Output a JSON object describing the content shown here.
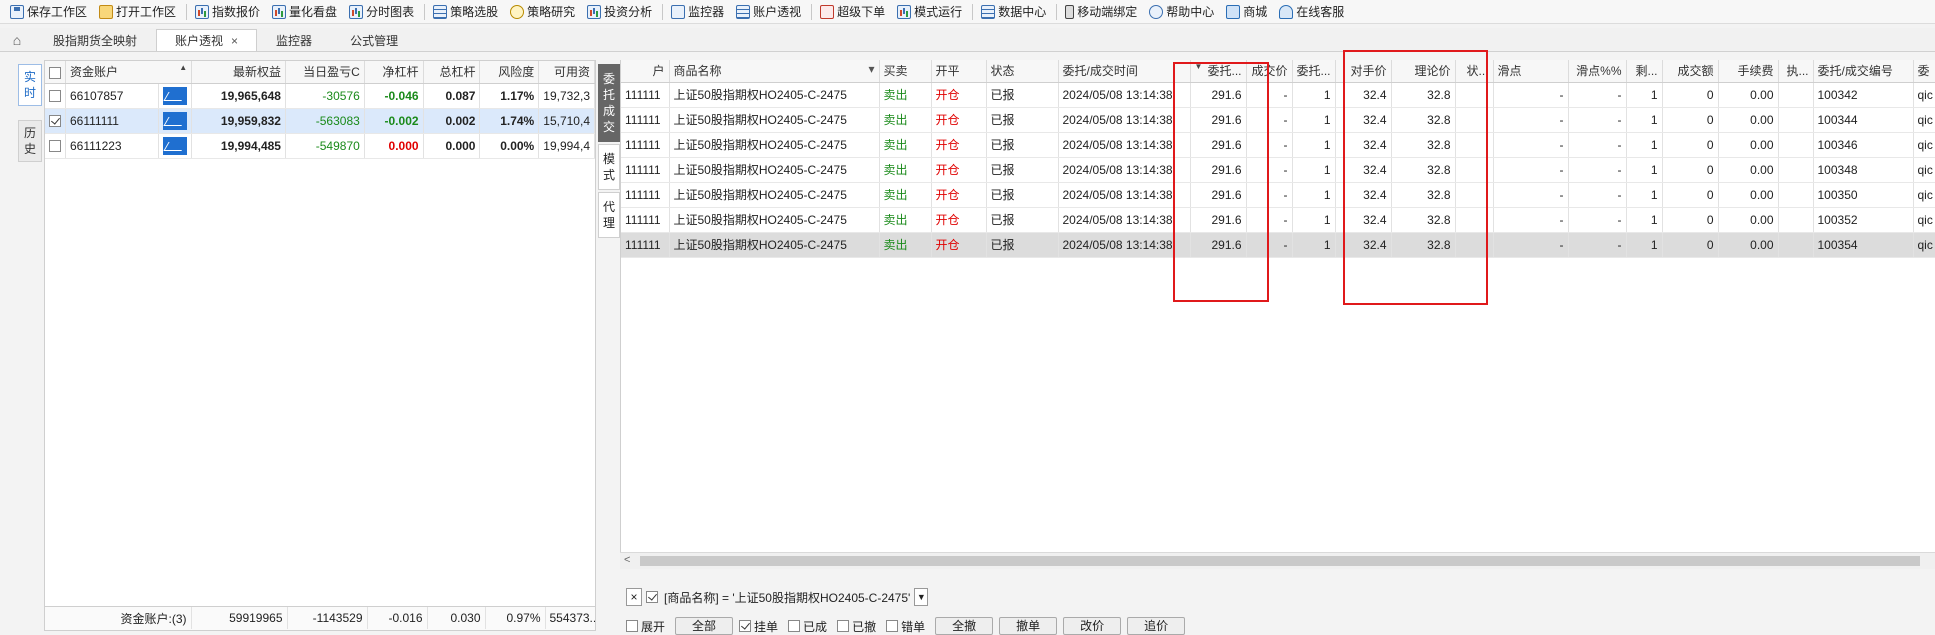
{
  "toolbar": [
    {
      "label": "保存工作区",
      "icon": "save-icon"
    },
    {
      "label": "打开工作区",
      "icon": "folder-icon"
    },
    {
      "label": "指数报价",
      "icon": "chart-icon"
    },
    {
      "label": "量化看盘",
      "icon": "chart-icon"
    },
    {
      "label": "分时图表",
      "icon": "chart-icon"
    },
    {
      "label": "策略选股",
      "icon": "grid-icon"
    },
    {
      "label": "策略研究",
      "icon": "bulb-icon"
    },
    {
      "label": "投资分析",
      "icon": "chart-icon"
    },
    {
      "label": "监控器",
      "icon": "monitor-icon"
    },
    {
      "label": "账户透视",
      "icon": "grid-icon"
    },
    {
      "label": "超级下单",
      "icon": "red-icon"
    },
    {
      "label": "模式运行",
      "icon": "chart-icon"
    },
    {
      "label": "数据中心",
      "icon": "grid-icon"
    },
    {
      "label": "移动端绑定",
      "icon": "phone-icon"
    },
    {
      "label": "帮助中心",
      "icon": "help-icon"
    },
    {
      "label": "商城",
      "icon": "shop-icon"
    },
    {
      "label": "在线客服",
      "icon": "person-icon"
    }
  ],
  "tabs": [
    {
      "label": "股指期货全映射",
      "active": false
    },
    {
      "label": "账户透视",
      "active": true,
      "close": "×"
    },
    {
      "label": "监控器",
      "active": false
    },
    {
      "label": "公式管理",
      "active": false
    }
  ],
  "left_vtabs": [
    {
      "label": "实\n时",
      "active": true
    },
    {
      "label": "历\n史",
      "active": false
    }
  ],
  "left_table": {
    "headers": [
      "资金账户",
      "最新权益",
      "当日盈亏C",
      "净杠杆",
      "总杠杆",
      "风险度",
      "可用资"
    ],
    "rows": [
      {
        "checked": false,
        "account": "66107857",
        "equity": "19,965,648",
        "pnl": "-30576",
        "net_lev": "-0.046",
        "tot_lev": "0.087",
        "risk": "1.17%",
        "avail": "19,732,3"
      },
      {
        "checked": true,
        "account": "66111111",
        "equity": "19,959,832",
        "pnl": "-563083",
        "net_lev": "-0.002",
        "tot_lev": "0.002",
        "risk": "1.74%",
        "avail": "15,710,4"
      },
      {
        "checked": false,
        "account": "66111223",
        "equity": "19,994,485",
        "pnl": "-549870",
        "net_lev": "0.000",
        "tot_lev": "0.000",
        "risk": "0.00%",
        "avail": "19,994,4"
      }
    ],
    "footer": {
      "label": "资金账户:(3)",
      "equity": "59919965",
      "pnl": "-1143529",
      "net_lev": "-0.016",
      "tot_lev": "0.030",
      "risk": "0.97%",
      "avail": "554373..."
    }
  },
  "mid_vtabs": [
    {
      "label": "委\n托\n成\n交",
      "active": true
    },
    {
      "label": "模\n式",
      "active": false
    },
    {
      "label": "代\n理",
      "active": false
    }
  ],
  "right_table": {
    "headers": [
      "户",
      "商品名称",
      "买卖",
      "开平",
      "状态",
      "委托/成交时间",
      "委托...",
      "成交价",
      "委托...",
      "对手价",
      "理论价",
      "状...",
      "滑点",
      "滑点%%",
      "剩...",
      "成交额",
      "手续费",
      "执...",
      "委托/成交编号",
      "委"
    ],
    "rows": [
      {
        "acct": "111111",
        "name": "上证50股指期权HO2405-C-2475",
        "bs": "卖出",
        "oc": "开仓",
        "status": "已报",
        "time": "2024/05/08 13:14:38",
        "price": "291.6",
        "deal": "-",
        "qty": "1",
        "opp": "32.4",
        "theo": "32.8",
        "st": "",
        "slip": "-",
        "slipp": "-",
        "rem": "1",
        "amt": "0",
        "fee": "0.00",
        "exe": "",
        "id": "100342",
        "who": "qic"
      },
      {
        "acct": "111111",
        "name": "上证50股指期权HO2405-C-2475",
        "bs": "卖出",
        "oc": "开仓",
        "status": "已报",
        "time": "2024/05/08 13:14:38",
        "price": "291.6",
        "deal": "-",
        "qty": "1",
        "opp": "32.4",
        "theo": "32.8",
        "st": "",
        "slip": "-",
        "slipp": "-",
        "rem": "1",
        "amt": "0",
        "fee": "0.00",
        "exe": "",
        "id": "100344",
        "who": "qic"
      },
      {
        "acct": "111111",
        "name": "上证50股指期权HO2405-C-2475",
        "bs": "卖出",
        "oc": "开仓",
        "status": "已报",
        "time": "2024/05/08 13:14:38",
        "price": "291.6",
        "deal": "-",
        "qty": "1",
        "opp": "32.4",
        "theo": "32.8",
        "st": "",
        "slip": "-",
        "slipp": "-",
        "rem": "1",
        "amt": "0",
        "fee": "0.00",
        "exe": "",
        "id": "100346",
        "who": "qic"
      },
      {
        "acct": "111111",
        "name": "上证50股指期权HO2405-C-2475",
        "bs": "卖出",
        "oc": "开仓",
        "status": "已报",
        "time": "2024/05/08 13:14:38",
        "price": "291.6",
        "deal": "-",
        "qty": "1",
        "opp": "32.4",
        "theo": "32.8",
        "st": "",
        "slip": "-",
        "slipp": "-",
        "rem": "1",
        "amt": "0",
        "fee": "0.00",
        "exe": "",
        "id": "100348",
        "who": "qic"
      },
      {
        "acct": "111111",
        "name": "上证50股指期权HO2405-C-2475",
        "bs": "卖出",
        "oc": "开仓",
        "status": "已报",
        "time": "2024/05/08 13:14:38",
        "price": "291.6",
        "deal": "-",
        "qty": "1",
        "opp": "32.4",
        "theo": "32.8",
        "st": "",
        "slip": "-",
        "slipp": "-",
        "rem": "1",
        "amt": "0",
        "fee": "0.00",
        "exe": "",
        "id": "100350",
        "who": "qic"
      },
      {
        "acct": "111111",
        "name": "上证50股指期权HO2405-C-2475",
        "bs": "卖出",
        "oc": "开仓",
        "status": "已报",
        "time": "2024/05/08 13:14:38",
        "price": "291.6",
        "deal": "-",
        "qty": "1",
        "opp": "32.4",
        "theo": "32.8",
        "st": "",
        "slip": "-",
        "slipp": "-",
        "rem": "1",
        "amt": "0",
        "fee": "0.00",
        "exe": "",
        "id": "100352",
        "who": "qic"
      },
      {
        "acct": "111111",
        "name": "上证50股指期权HO2405-C-2475",
        "bs": "卖出",
        "oc": "开仓",
        "status": "已报",
        "time": "2024/05/08 13:14:38",
        "price": "291.6",
        "deal": "-",
        "qty": "1",
        "opp": "32.4",
        "theo": "32.8",
        "st": "",
        "slip": "-",
        "slipp": "-",
        "rem": "1",
        "amt": "0",
        "fee": "0.00",
        "exe": "",
        "id": "100354",
        "who": "qic"
      }
    ]
  },
  "filter": {
    "close": "×",
    "text": "[商品名称] = '上证50股指期权HO2405-C-2475'",
    "bottom": [
      "展开",
      "全部",
      "挂单",
      "已成",
      "已撤",
      "错单",
      "全撤",
      "撤单",
      "改价",
      "追价"
    ]
  },
  "colors": {
    "sell": "#1a8a1a",
    "open": "#e00000",
    "highlight": "#e0191b",
    "selected_row": "#dbe9fb"
  }
}
